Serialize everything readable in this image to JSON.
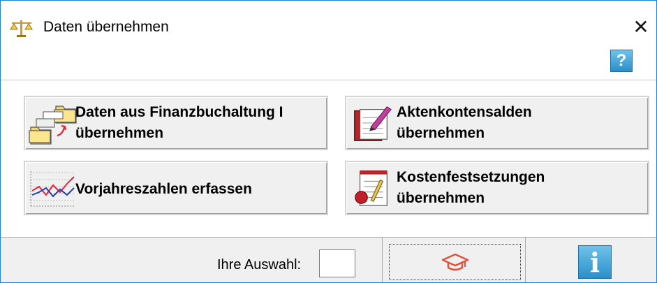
{
  "window": {
    "title": "Daten übernehmen",
    "close_glyph": "✕",
    "help_glyph": "?"
  },
  "buttons": [
    {
      "name": "finanzbuchhaltung",
      "line1": "Daten aus Finanzbuchaltung I",
      "line2": "übernehmen",
      "icon": "folders-transfer-icon"
    },
    {
      "name": "aktenkontensalden",
      "line1": "Aktenkontensalden",
      "line2": "übernehmen",
      "icon": "ledger-pen-icon"
    },
    {
      "name": "vorjahreszahlen",
      "line1": "Vorjahreszahlen erfassen",
      "line2": "",
      "icon": "line-chart-icon"
    },
    {
      "name": "kostenfestsetzungen",
      "line1": "Kostenfestsetzungen",
      "line2": "übernehmen",
      "icon": "notepad-stamp-icon"
    }
  ],
  "footer": {
    "selection_label": "Ihre Auswahl:",
    "selection_value": "",
    "graduation_icon": "mortarboard-icon",
    "info_glyph": "i"
  },
  "colors": {
    "window_border": "#1883d7",
    "accent_red": "#e0533a",
    "info_blue": "#2a8fc9"
  }
}
